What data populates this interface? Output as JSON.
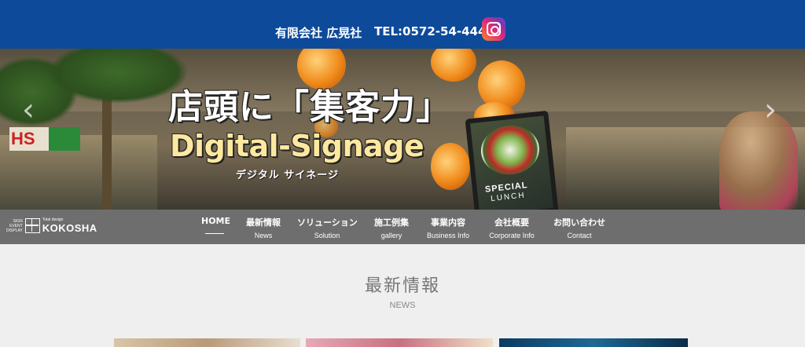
{
  "topbar": {
    "company": "有限会社 広晃社",
    "tel": "TEL:0572-54-4447",
    "instagram_icon": "instagram-icon"
  },
  "hero": {
    "headline": "店頭に「集客力」",
    "subheadline": "Digital-Signage",
    "kana": "デジタル サイネージ",
    "store_sign": "HS",
    "tablet_title": "SPECIAL",
    "tablet_sub": "LUNCH",
    "prev_arrow": "‹",
    "next_arrow": "›"
  },
  "logo": {
    "small_lines": [
      "SIGN",
      "EVENT",
      "DISPLAY"
    ],
    "tagline": "Total design",
    "name": "KOKOSHA"
  },
  "nav": {
    "items": [
      {
        "jp": "HOME",
        "en": ""
      },
      {
        "jp": "最新情報",
        "en": "News"
      },
      {
        "jp": "ソリューション",
        "en": "Solution"
      },
      {
        "jp": "施工例集",
        "en": "gallery"
      },
      {
        "jp": "事業内容",
        "en": "Business Info"
      },
      {
        "jp": "会社概要",
        "en": "Corporate Info"
      },
      {
        "jp": "お問い合わせ",
        "en": "Contact"
      }
    ]
  },
  "news_section": {
    "title": "最新情報",
    "subtitle": "NEWS"
  },
  "colors": {
    "topbar": "#0d4a9a",
    "nav": "#6e6e6e",
    "page_bg": "#efefef"
  }
}
